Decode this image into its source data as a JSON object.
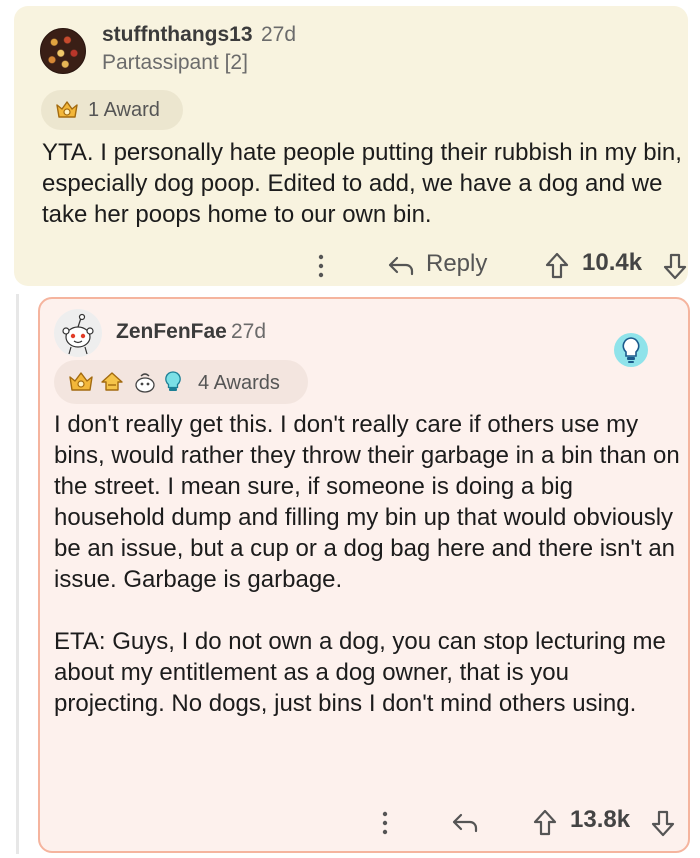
{
  "comments": [
    {
      "username": "stuffnthangs13",
      "age": "27d",
      "flair": "Partassipant [2]",
      "awards_label": "1 Award",
      "body": [
        "YTA.  I personally hate people putting their rubbish in my bin, especially dog poop. Edited to add, we have a dog and we take her poops home to our own bin."
      ],
      "reply_label": "Reply",
      "score": "10.4k"
    },
    {
      "username": "ZenFenFae",
      "age": "27d",
      "awards_label": "4 Awards",
      "body": [
        "I don't really get this. I don't really care if others use my bins, would rather they throw their garbage in a bin than on the street. I mean sure, if someone is doing a big household dump and filling my bin up that would obviously be an issue, but a cup or a dog bag here and there isn't an issue. Garbage is garbage.",
        "ETA: Guys, I do not own a dog, you can stop lecturing me about my entitlement as a dog owner, that is you projecting. No dogs, just bins I don't mind others using."
      ],
      "score": "13.8k"
    }
  ],
  "icons": {
    "award": "award-crown-icon",
    "more": "more-vertical-icon",
    "reply": "reply-arrow-icon",
    "upvote": "upvote-arrow-icon",
    "downvote": "downvote-arrow-icon",
    "flair": "lightbulb-icon"
  },
  "colors": {
    "comment1_bg": "#f8f3df",
    "comment2_bg": "#fdf1ed",
    "highlight_border": "#f5b49e",
    "award_gold": "#f3b73a"
  }
}
